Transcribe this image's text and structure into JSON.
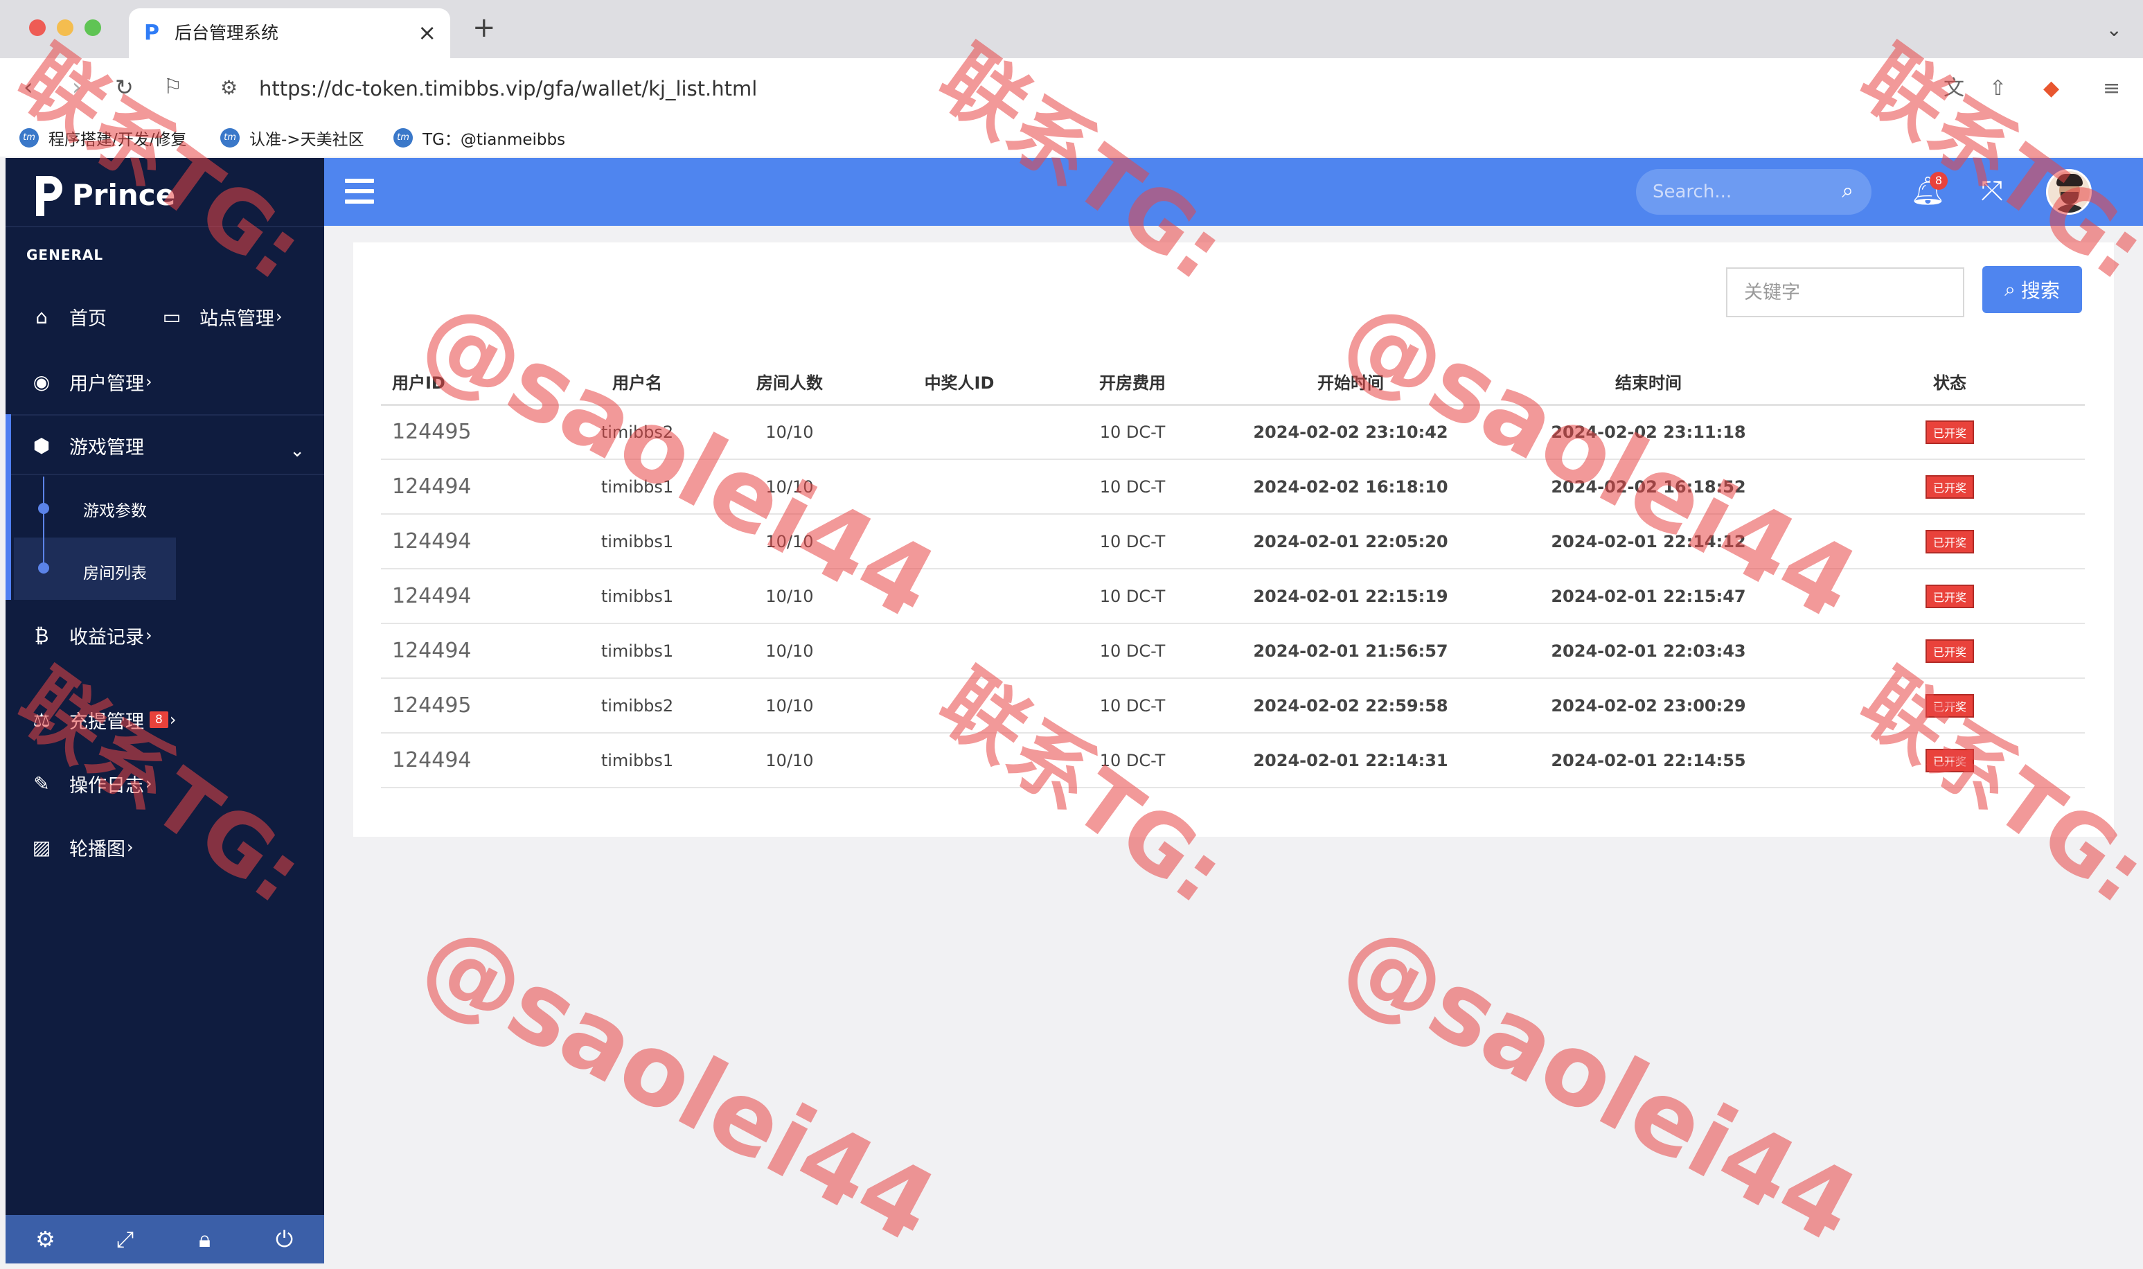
{
  "browser": {
    "tab_title": "后台管理系统",
    "url": "https://dc-token.timibbs.vip/gfa/wallet/kj_list.html",
    "bookmarks": [
      "程序搭建/开发/修复",
      "认准->天美社区",
      "TG：@tianmeibbs"
    ]
  },
  "brand": {
    "name": "Prince"
  },
  "sidebar": {
    "heading": "GENERAL",
    "home": "首页",
    "site_mgmt": "站点管理",
    "user_mgmt": "用户管理",
    "game_mgmt": "游戏管理",
    "game_sub": [
      "游戏参数",
      "房间列表"
    ],
    "income": "收益记录",
    "recharge": "充提管理",
    "recharge_badge": "8",
    "op_log": "操作日志",
    "carousel": "轮播图"
  },
  "topbar": {
    "search_placeholder": "Search...",
    "notification_count": "8"
  },
  "filter": {
    "keyword_placeholder": "关键字",
    "search_label": "搜索"
  },
  "table": {
    "headers": [
      "用户ID",
      "用户名",
      "房间人数",
      "中奖人ID",
      "开房费用",
      "开始时间",
      "结束时间",
      "状态"
    ],
    "rows": [
      [
        "124495",
        "timibbs2",
        "10/10",
        "",
        "10 DC-T",
        "2024-02-02 23:10:42",
        "2024-02-02 23:11:18",
        "已开奖"
      ],
      [
        "124494",
        "timibbs1",
        "10/10",
        "",
        "10 DC-T",
        "2024-02-02 16:18:10",
        "2024-02-02 16:18:52",
        "已开奖"
      ],
      [
        "124494",
        "timibbs1",
        "10/10",
        "",
        "10 DC-T",
        "2024-02-01 22:05:20",
        "2024-02-01 22:14:12",
        "已开奖"
      ],
      [
        "124494",
        "timibbs1",
        "10/10",
        "",
        "10 DC-T",
        "2024-02-01 22:15:19",
        "2024-02-01 22:15:47",
        "已开奖"
      ],
      [
        "124494",
        "timibbs1",
        "10/10",
        "",
        "10 DC-T",
        "2024-02-01 21:56:57",
        "2024-02-01 22:03:43",
        "已开奖"
      ],
      [
        "124495",
        "timibbs2",
        "10/10",
        "",
        "10 DC-T",
        "2024-02-02 22:59:58",
        "2024-02-02 23:00:29",
        "已开奖"
      ],
      [
        "124494",
        "timibbs1",
        "10/10",
        "",
        "10 DC-T",
        "2024-02-01 22:14:31",
        "2024-02-01 22:14:55",
        "已开奖"
      ]
    ]
  },
  "watermark": {
    "line1": "联系TG:",
    "line2": "@saolei44"
  },
  "colors": {
    "sidebar_bg": "#0f1c3f",
    "topbar_bg": "#4f85ef",
    "accent": "#4f85ef",
    "start_time": "#d9322c",
    "status_tag": "#e9423b",
    "watermark": "#e84646"
  }
}
